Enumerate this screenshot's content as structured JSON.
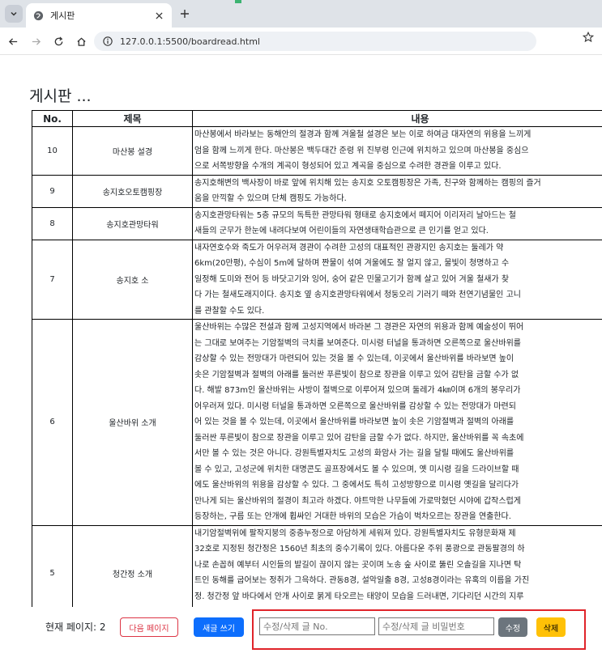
{
  "browser": {
    "tab_title": "게시판",
    "url": "127.0.0.1:5500/boardread.html"
  },
  "page": {
    "title": "게시판 ...",
    "columns": {
      "no": "No.",
      "title": "제목",
      "content": "내용"
    },
    "rows": [
      {
        "no": "10",
        "title": "마산봉 설경",
        "lines": [
          "마산봉에서 바라보는 동해안의 절경과 함께 겨울철 설경은 보는 이로 하여금 대자연의 위용을 느끼게",
          "엄을 함께 느끼게 한다. 마산봉은 백두대간 준령 위 진부령 인근에 위치하고 있으며 마산봉을 중심으",
          "으로 서쪽방향을 수개의 계곡이 형성되어 있고 계곡을 중심으로 수려한 경관을 이루고 있다."
        ]
      },
      {
        "no": "9",
        "title": "송지호오토캠핑장",
        "lines": [
          "송지호해변의 백사장이 바로 앞에 위치해 있는 송지호 오토캠핑장은 가족, 친구와 함께하는 캠핑의 즐거",
          "움을 만끽할 수 있으며 단체 캠핑도 가능하다."
        ]
      },
      {
        "no": "8",
        "title": "송지호관망타워",
        "lines": [
          "송지호관망타워는 5층 규모의 독특한 관망타워 형태로 송지호에서 떼지어 이리저리 날아드는 철",
          "새들의 군무가 한눈에 내려다보여 어린이들의 자연생태학습관으로 큰 인기를 얻고 있다."
        ]
      },
      {
        "no": "7",
        "title": "송지호 소",
        "lines": [
          "내자연호수와 죽도가 어우러져 경관이 수려한 고성의 대표적인 관광지인 송지호는 둘레가 약",
          "6km(20만평), 수심이 5m에 달하며 짠물이 섞여 겨울에도 잘 얼지 않고, 물빛이 청명하고 수",
          "일정해 도미와 전어 등 바닷고기와 잉어, 숭어 같은 민물고기가 함께 살고 있어 겨울 철새가 찾",
          "다 가는 철새도래지이다. 송지호 옆 송지호관망타워에서 청둥오리 기러기 떼와 천연기념물인 고니",
          "를 관찰할 수도 있다."
        ]
      },
      {
        "no": "6",
        "title": "울산바위 소개",
        "lines": [
          "울산바위는 수많은 전설과 함께 고성지역에서 바라본 그 경관은 자연의 위용과 함께 예술성이 뛰어",
          "는 그대로 보여주는 기암절벽의 극치를 보여준다. 미시령 터널을 통과하면 오른쪽으로 울산바위를",
          "감상할 수 있는 전망대가 마련되어 있는 것을 볼 수 있는데, 이곳에서 울산바위를 바라보면 높이",
          "솟은 기암절벽과 절벽의 아래를 둘러싼 푸른빛이 참으로 장관을 이루고 있어 감탄을 금할 수가 없",
          "다. 해발 873m인 울산바위는 사방이 절벽으로 이루어져 있으며 둘레가 4㎞이며 6개의 봉우리가",
          "어우러져 있다. 미시령 터널을 통과하면 오른쪽으로 울산바위를 감상할 수 있는 전망대가 마련되",
          "어 있는 것을 볼 수 있는데, 이곳에서 울산바위를 바라보면 높이 솟은 기암절벽과 절벽의 아래를",
          "둘러싼 푸른빛이 참으로 장관을 이루고 있어 감탄을 금할 수가 없다. 하지만, 울산바위를 꼭 속초에",
          "서만 볼 수 있는 것은 아니다. 강원특별자치도 고성의 화암사 가는 길을 달릴 때에도 울산바위를",
          "볼 수 있고, 고성군에 위치한 대명콘도 골프장에서도 볼 수 있으며, 옛 미시령 길을 드라이브할 때",
          "에도 울산바위의 위용을 감상할 수 있다. 그 중에서도 특히 고성방향으로 미시령 옛길을 달리다가",
          "만나게 되는 울산바위의 절경이 최고라 하겠다. 야트막한 나무들에 가로막혔던 시야에 갑작스럽게",
          "등장하는, 구름 또는 안개에 휩싸인 거대한 바위의 모습은 가슴이 벅차오르는 장관을 연출한다."
        ]
      },
      {
        "no": "5",
        "title": "청간정 소개",
        "lines": [
          "내기암절벽위에 팔작지붕의 중층누정으로 아담하게 세워져 있다. 강원특별자치도 유형문화재 제",
          "32호로 지정된 청간정은 1560년 최초의 중수기록이 있다. 아름다운 주위 풍광으로 관동팔경의 하",
          "나로 손꼽혀 예부터 시인들의 발길이 끊이지 않는 곳이며 노송 숲 사이로 뚫린 오솔길을 지나면 탁",
          "트인 동해를 굽어보는 정취가 그윽하다. 관동8경, 설악일출 8경, 고성8경이라는 유혹의 이름을 가진",
          "정. 청간정 앞 바다에서 안개 사이로 붉게 타오르는 태양이 모습을 드러내면, 기다리던 시간의 지루",
          "잊고 그저 탄성만이 가득하다."
        ]
      }
    ]
  },
  "controls": {
    "current_page_label": "현재 페이지: 2",
    "next_page": "다음 페이지",
    "write": "새글 쓰기",
    "no_placeholder": "수정/삭제 글 No.",
    "pw_placeholder": "수정/삭제 글 비밀번호",
    "edit": "수정",
    "delete": "삭제"
  }
}
